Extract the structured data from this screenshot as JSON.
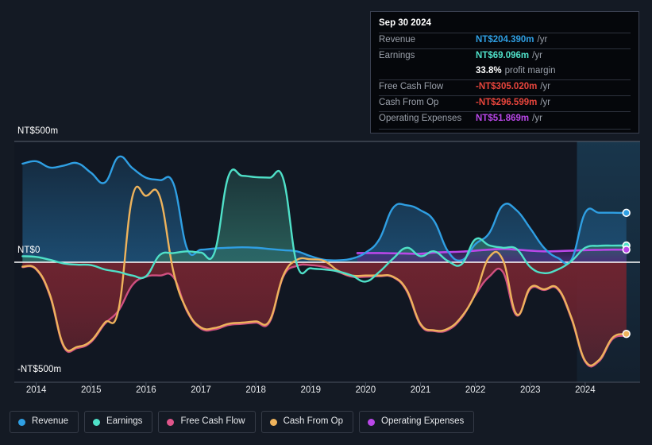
{
  "chart_data": {
    "type": "area",
    "title": "",
    "xlabel": "",
    "ylabel": "",
    "currency": "NT$",
    "unit": "m",
    "grid": true,
    "legend_position": "bottom",
    "ylim": [
      -500,
      500
    ],
    "y_ticks": [
      {
        "value": 500,
        "label": "NT$500m"
      },
      {
        "value": 0,
        "label": "NT$0"
      },
      {
        "value": -500,
        "label": "-NT$500m"
      }
    ],
    "x_ticks": [
      "2014",
      "2015",
      "2016",
      "2017",
      "2018",
      "2019",
      "2020",
      "2021",
      "2022",
      "2023",
      "2024"
    ],
    "xlim": [
      2013.6,
      2025.0
    ],
    "forecast_region": {
      "from": 2023.85,
      "to": 2025.0
    },
    "series": [
      {
        "name": "Revenue",
        "color": "#2f9fe3",
        "fill": "#1d4a6b",
        "x": [
          2013.75,
          2014.0,
          2014.25,
          2014.5,
          2014.75,
          2015.0,
          2015.25,
          2015.5,
          2015.75,
          2016.0,
          2016.25,
          2016.5,
          2016.75,
          2017.0,
          2017.25,
          2017.5,
          2017.75,
          2018.0,
          2018.25,
          2018.5,
          2018.75,
          2019.0,
          2019.25,
          2019.5,
          2019.75,
          2020.0,
          2020.25,
          2020.5,
          2020.75,
          2021.0,
          2021.25,
          2021.5,
          2021.75,
          2022.0,
          2022.25,
          2022.5,
          2022.75,
          2023.0,
          2023.25,
          2023.5,
          2023.75,
          2024.0,
          2024.25,
          2024.5,
          2024.75
        ],
        "y": [
          408,
          418,
          392,
          400,
          410,
          370,
          330,
          436,
          390,
          350,
          340,
          325,
          55,
          52,
          57,
          60,
          62,
          60,
          55,
          50,
          45,
          25,
          10,
          8,
          15,
          40,
          95,
          225,
          236,
          215,
          170,
          45,
          8,
          75,
          120,
          235,
          215,
          140,
          60,
          18,
          10,
          205,
          205,
          205,
          204
        ]
      },
      {
        "name": "Earnings",
        "color": "#4fe0c8",
        "fill": "#2b5a56",
        "x": [
          2013.75,
          2014.0,
          2014.25,
          2014.5,
          2014.75,
          2015.0,
          2015.25,
          2015.5,
          2015.75,
          2016.0,
          2016.25,
          2016.5,
          2016.75,
          2017.0,
          2017.25,
          2017.5,
          2017.75,
          2018.0,
          2018.25,
          2018.5,
          2018.75,
          2019.0,
          2019.25,
          2019.5,
          2019.75,
          2020.0,
          2020.25,
          2020.5,
          2020.75,
          2021.0,
          2021.25,
          2021.5,
          2021.75,
          2022.0,
          2022.25,
          2022.5,
          2022.75,
          2023.0,
          2023.25,
          2023.5,
          2023.75,
          2024.0,
          2024.25,
          2024.5,
          2024.75
        ],
        "y": [
          25,
          22,
          10,
          -5,
          -10,
          -12,
          -30,
          -40,
          -55,
          -58,
          30,
          38,
          45,
          40,
          42,
          355,
          358,
          352,
          350,
          345,
          -10,
          -25,
          -30,
          -38,
          -55,
          -80,
          -40,
          15,
          60,
          25,
          45,
          5,
          -8,
          95,
          70,
          60,
          55,
          -20,
          -45,
          -30,
          5,
          60,
          68,
          69,
          69
        ]
      },
      {
        "name": "Free Cash Flow",
        "color": "#e0558a",
        "fill": "#6b2232",
        "x": [
          2013.75,
          2014.0,
          2014.25,
          2014.5,
          2014.75,
          2015.0,
          2015.25,
          2015.5,
          2015.75,
          2016.0,
          2016.25,
          2016.5,
          2016.75,
          2017.0,
          2017.25,
          2017.5,
          2017.75,
          2018.0,
          2018.25,
          2018.5,
          2018.75,
          2019.0,
          2019.25,
          2019.5,
          2019.75,
          2020.0,
          2020.25,
          2020.5,
          2020.75,
          2021.0,
          2021.25,
          2021.5,
          2021.75,
          2022.0,
          2022.25,
          2022.5,
          2022.75,
          2023.0,
          2023.25,
          2023.5,
          2023.75,
          2024.0,
          2024.25,
          2024.5,
          2024.75
        ],
        "y": [
          -20,
          -30,
          -140,
          -350,
          -355,
          -330,
          -255,
          -200,
          -95,
          -60,
          -55,
          -62,
          -205,
          -275,
          -278,
          -260,
          -255,
          -250,
          -248,
          -60,
          -15,
          -12,
          -20,
          -40,
          -60,
          -60,
          -58,
          -62,
          -120,
          -260,
          -285,
          -280,
          -230,
          -135,
          -60,
          -40,
          -220,
          -110,
          -115,
          -112,
          -235,
          -412,
          -410,
          -318,
          -305
        ]
      },
      {
        "name": "Cash From Op",
        "color": "#eeb35c",
        "fill": "#6b2232",
        "x": [
          2013.75,
          2014.0,
          2014.25,
          2014.5,
          2014.75,
          2015.0,
          2015.25,
          2015.5,
          2015.75,
          2016.0,
          2016.25,
          2016.5,
          2016.75,
          2017.0,
          2017.25,
          2017.5,
          2017.75,
          2018.0,
          2018.25,
          2018.5,
          2018.75,
          2019.0,
          2019.25,
          2019.5,
          2019.75,
          2020.0,
          2020.25,
          2020.5,
          2020.75,
          2021.0,
          2021.25,
          2021.5,
          2021.75,
          2022.0,
          2022.25,
          2022.5,
          2022.75,
          2023.0,
          2023.25,
          2023.5,
          2023.75,
          2024.0,
          2024.25,
          2024.5,
          2024.75
        ],
        "y": [
          -18,
          -28,
          -135,
          -345,
          -350,
          -325,
          -250,
          -195,
          270,
          275,
          272,
          -40,
          -200,
          -270,
          -272,
          -255,
          -250,
          -245,
          -242,
          -55,
          10,
          12,
          5,
          -35,
          -55,
          -55,
          -55,
          -60,
          -115,
          -255,
          -282,
          -275,
          -225,
          -130,
          20,
          10,
          -215,
          -105,
          -112,
          -108,
          -230,
          -408,
          -405,
          -312,
          -297
        ]
      },
      {
        "name": "Operating Expenses",
        "color": "#b947e8",
        "fill": "#3d2a63",
        "x": [
          2019.85,
          2020.0,
          2020.25,
          2020.5,
          2020.75,
          2021.0,
          2021.25,
          2021.5,
          2021.75,
          2022.0,
          2022.25,
          2022.5,
          2022.75,
          2023.0,
          2023.25,
          2023.5,
          2023.75,
          2024.0,
          2024.25,
          2024.5,
          2024.75
        ],
        "y": [
          38,
          38,
          38,
          37,
          36,
          35,
          40,
          42,
          44,
          48,
          52,
          55,
          52,
          48,
          45,
          46,
          48,
          50,
          51,
          52,
          52
        ]
      }
    ],
    "endpoint_markers": [
      {
        "series": "Revenue",
        "x": 2024.75,
        "y": 204.39,
        "color": "#2f9fe3"
      },
      {
        "series": "Earnings",
        "x": 2024.75,
        "y": 69.096,
        "color": "#4fe0c8"
      },
      {
        "series": "Operating Expenses",
        "x": 2024.75,
        "y": 51.869,
        "color": "#b947e8"
      },
      {
        "series": "Cash From Op",
        "x": 2024.75,
        "y": -296.599,
        "color": "#eeb35c"
      }
    ]
  },
  "tooltip": {
    "date": "Sep 30 2024",
    "rows": [
      {
        "key": "Revenue",
        "value": "NT$204.390m",
        "unit": "/yr",
        "color": "#2f9fe3"
      },
      {
        "key": "Earnings",
        "value": "NT$69.096m",
        "unit": "/yr",
        "color": "#4fe0c8"
      },
      {
        "key": "",
        "value": "33.8%",
        "unit": "profit margin",
        "color": "#ffffff"
      },
      {
        "key": "Free Cash Flow",
        "value": "-NT$305.020m",
        "unit": "/yr",
        "color": "#e8453c"
      },
      {
        "key": "Cash From Op",
        "value": "-NT$296.599m",
        "unit": "/yr",
        "color": "#e8453c"
      },
      {
        "key": "Operating Expenses",
        "value": "NT$51.869m",
        "unit": "/yr",
        "color": "#b947e8"
      }
    ]
  },
  "legend": {
    "items": [
      {
        "label": "Revenue",
        "color": "#2f9fe3"
      },
      {
        "label": "Earnings",
        "color": "#4fe0c8"
      },
      {
        "label": "Free Cash Flow",
        "color": "#e0558a"
      },
      {
        "label": "Cash From Op",
        "color": "#eeb35c"
      },
      {
        "label": "Operating Expenses",
        "color": "#b947e8"
      }
    ]
  }
}
